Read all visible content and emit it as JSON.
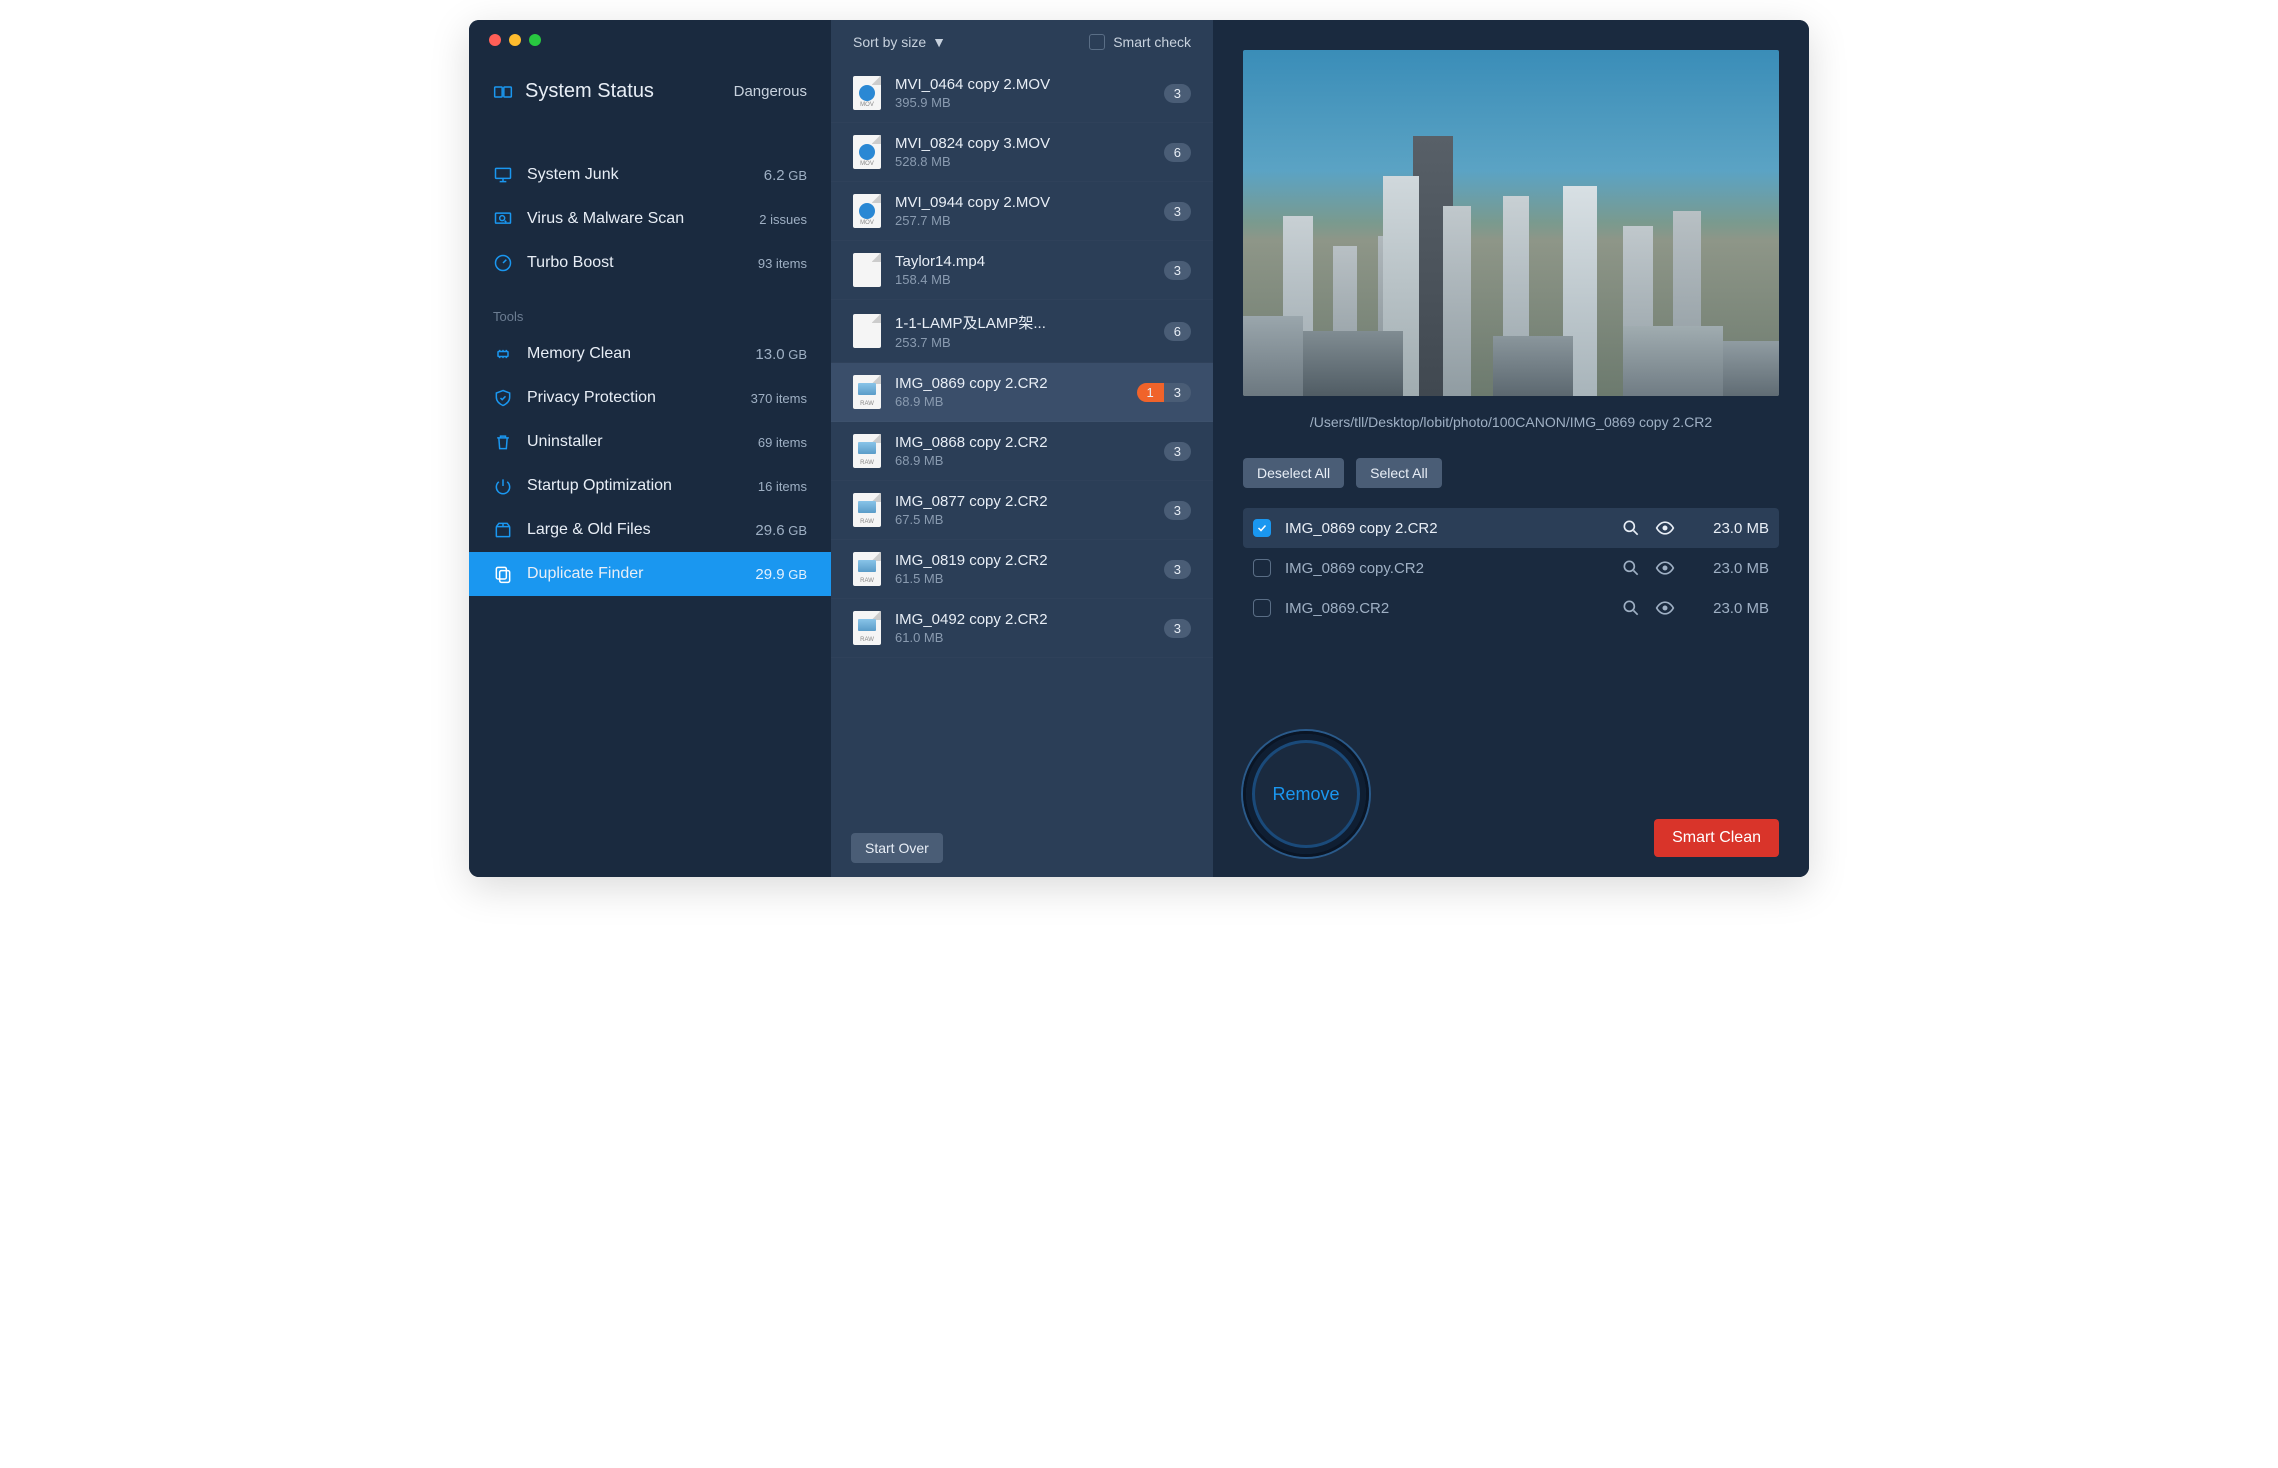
{
  "status": {
    "title": "System Status",
    "value": "Dangerous"
  },
  "nav_main": [
    {
      "label": "System Junk",
      "value": "6.2",
      "unit": "GB",
      "icon": "monitor"
    },
    {
      "label": "Virus & Malware Scan",
      "value": "2 issues",
      "unit": "",
      "icon": "monitor-search"
    },
    {
      "label": "Turbo Boost",
      "value": "93 items",
      "unit": "",
      "icon": "gauge"
    }
  ],
  "tools_label": "Tools",
  "nav_tools": [
    {
      "label": "Memory Clean",
      "value": "13.0",
      "unit": "GB",
      "icon": "chip"
    },
    {
      "label": "Privacy Protection",
      "value": "370 items",
      "unit": "",
      "icon": "shield"
    },
    {
      "label": "Uninstaller",
      "value": "69 items",
      "unit": "",
      "icon": "trash"
    },
    {
      "label": "Startup Optimization",
      "value": "16 items",
      "unit": "",
      "icon": "power"
    },
    {
      "label": "Large & Old Files",
      "value": "29.6",
      "unit": "GB",
      "icon": "box"
    },
    {
      "label": "Duplicate Finder",
      "value": "29.9",
      "unit": "GB",
      "icon": "copy",
      "active": true
    }
  ],
  "sort_label": "Sort by size",
  "smart_check_label": "Smart check",
  "files": [
    {
      "name": "MVI_0464 copy 2.MOV",
      "size": "395.9 MB",
      "count": "3",
      "type": "mov"
    },
    {
      "name": "MVI_0824 copy 3.MOV",
      "size": "528.8 MB",
      "count": "6",
      "type": "mov"
    },
    {
      "name": "MVI_0944 copy 2.MOV",
      "size": "257.7 MB",
      "count": "3",
      "type": "mov"
    },
    {
      "name": "Taylor14.mp4",
      "size": "158.4 MB",
      "count": "3",
      "type": "doc"
    },
    {
      "name": "1-1-LAMP及LAMP架...",
      "size": "253.7 MB",
      "count": "6",
      "type": "doc"
    },
    {
      "name": "IMG_0869 copy 2.CR2",
      "size": "68.9 MB",
      "count": "3",
      "alert": "1",
      "type": "raw",
      "selected": true
    },
    {
      "name": "IMG_0868 copy 2.CR2",
      "size": "68.9 MB",
      "count": "3",
      "type": "raw"
    },
    {
      "name": "IMG_0877 copy 2.CR2",
      "size": "67.5 MB",
      "count": "3",
      "type": "raw"
    },
    {
      "name": "IMG_0819 copy 2.CR2",
      "size": "61.5 MB",
      "count": "3",
      "type": "raw"
    },
    {
      "name": "IMG_0492 copy 2.CR2",
      "size": "61.0 MB",
      "count": "3",
      "type": "raw"
    }
  ],
  "start_over": "Start Over",
  "preview_path": "/Users/tll/Desktop/lobit/photo/100CANON/IMG_0869 copy 2.CR2",
  "deselect_all": "Deselect All",
  "select_all": "Select All",
  "duplicates": [
    {
      "name": "IMG_0869 copy 2.CR2",
      "size": "23.0 MB",
      "checked": true
    },
    {
      "name": "IMG_0869 copy.CR2",
      "size": "23.0 MB",
      "checked": false
    },
    {
      "name": "IMG_0869.CR2",
      "size": "23.0 MB",
      "checked": false
    }
  ],
  "remove_label": "Remove",
  "smart_clean": "Smart Clean"
}
